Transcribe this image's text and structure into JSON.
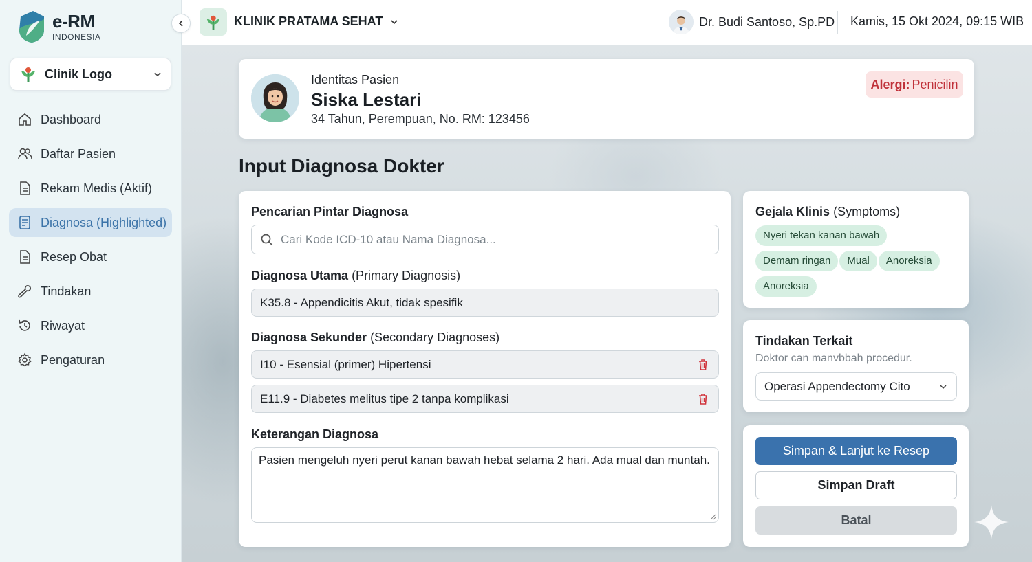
{
  "app": {
    "logo_title": "e-RM",
    "logo_subtitle": "INDONESIA"
  },
  "sidebar": {
    "clinic_select": "Clinik Logo",
    "items": [
      {
        "label": "Dashboard",
        "icon": "home-icon"
      },
      {
        "label": "Daftar Pasien",
        "icon": "users-icon"
      },
      {
        "label": "Rekam Medis (Aktif)",
        "icon": "document-icon"
      },
      {
        "label": "Diagnosa (Highlighted)",
        "icon": "list-document-icon",
        "active": true
      },
      {
        "label": "Resep Obat",
        "icon": "document-icon"
      },
      {
        "label": "Tindakan",
        "icon": "wrench-icon"
      },
      {
        "label": "Riwayat",
        "icon": "history-icon"
      },
      {
        "label": "Pengaturan",
        "icon": "gear-icon"
      }
    ]
  },
  "header": {
    "clinic_name": "KLINIK PRATAMA SEHAT",
    "doctor_name": "Dr. Budi Santoso, Sp.PD",
    "datetime": "Kamis, 15 Okt 2024, 09:15 WIB"
  },
  "patient": {
    "section_label": "Identitas Pasien",
    "name": "Siska Lestari",
    "info": "34 Tahun, Perempuan, No. RM: 123456",
    "allergy_label": "Alergi:",
    "allergy_value": "Penicilin"
  },
  "page": {
    "title": "Input Diagnosa Dokter"
  },
  "diagnosis": {
    "search_label": "Pencarian Pintar Diagnosa",
    "search_placeholder": "Cari Kode ICD-10 atau Nama Diagnosa...",
    "primary_label": "Diagnosa Utama",
    "primary_label_en": "(Primary Diagnosis)",
    "primary_value": "K35.8 - Appendicitis Akut, tidak spesifik",
    "secondary_label": "Diagnosa Sekunder",
    "secondary_label_en": "(Secondary Diagnoses)",
    "secondary": [
      "I10 - Esensial (primer) Hipertensi",
      "E11.9 - Diabetes melitus tipe 2 tanpa komplikasi"
    ],
    "notes_label": "Keterangan Diagnosa",
    "notes_value": "Pasien mengeluh nyeri perut kanan bawah hebat selama 2 hari. Ada mual dan muntah."
  },
  "symptoms": {
    "title": "Gejala Klinis",
    "title_en": "(Symptoms)",
    "chips": [
      "Nyeri tekan kanan bawah",
      "Demam ringan",
      "Mual",
      "Anoreksia",
      "Anoreksia"
    ]
  },
  "action": {
    "title": "Tindakan Terkait",
    "subtitle": "Doktor can manvbbah procedur.",
    "selected": "Operasi Appendectomy Cito"
  },
  "buttons": {
    "primary": "Simpan & Lanjut ke Resep",
    "draft": "Simpan Draft",
    "cancel": "Batal"
  },
  "colors": {
    "accent": "#3a72ad",
    "active_bg": "#d3e3f0",
    "chip_bg": "#d6efe2",
    "allergy_bg": "#fbe3e3",
    "allergy_text": "#c0313a"
  }
}
